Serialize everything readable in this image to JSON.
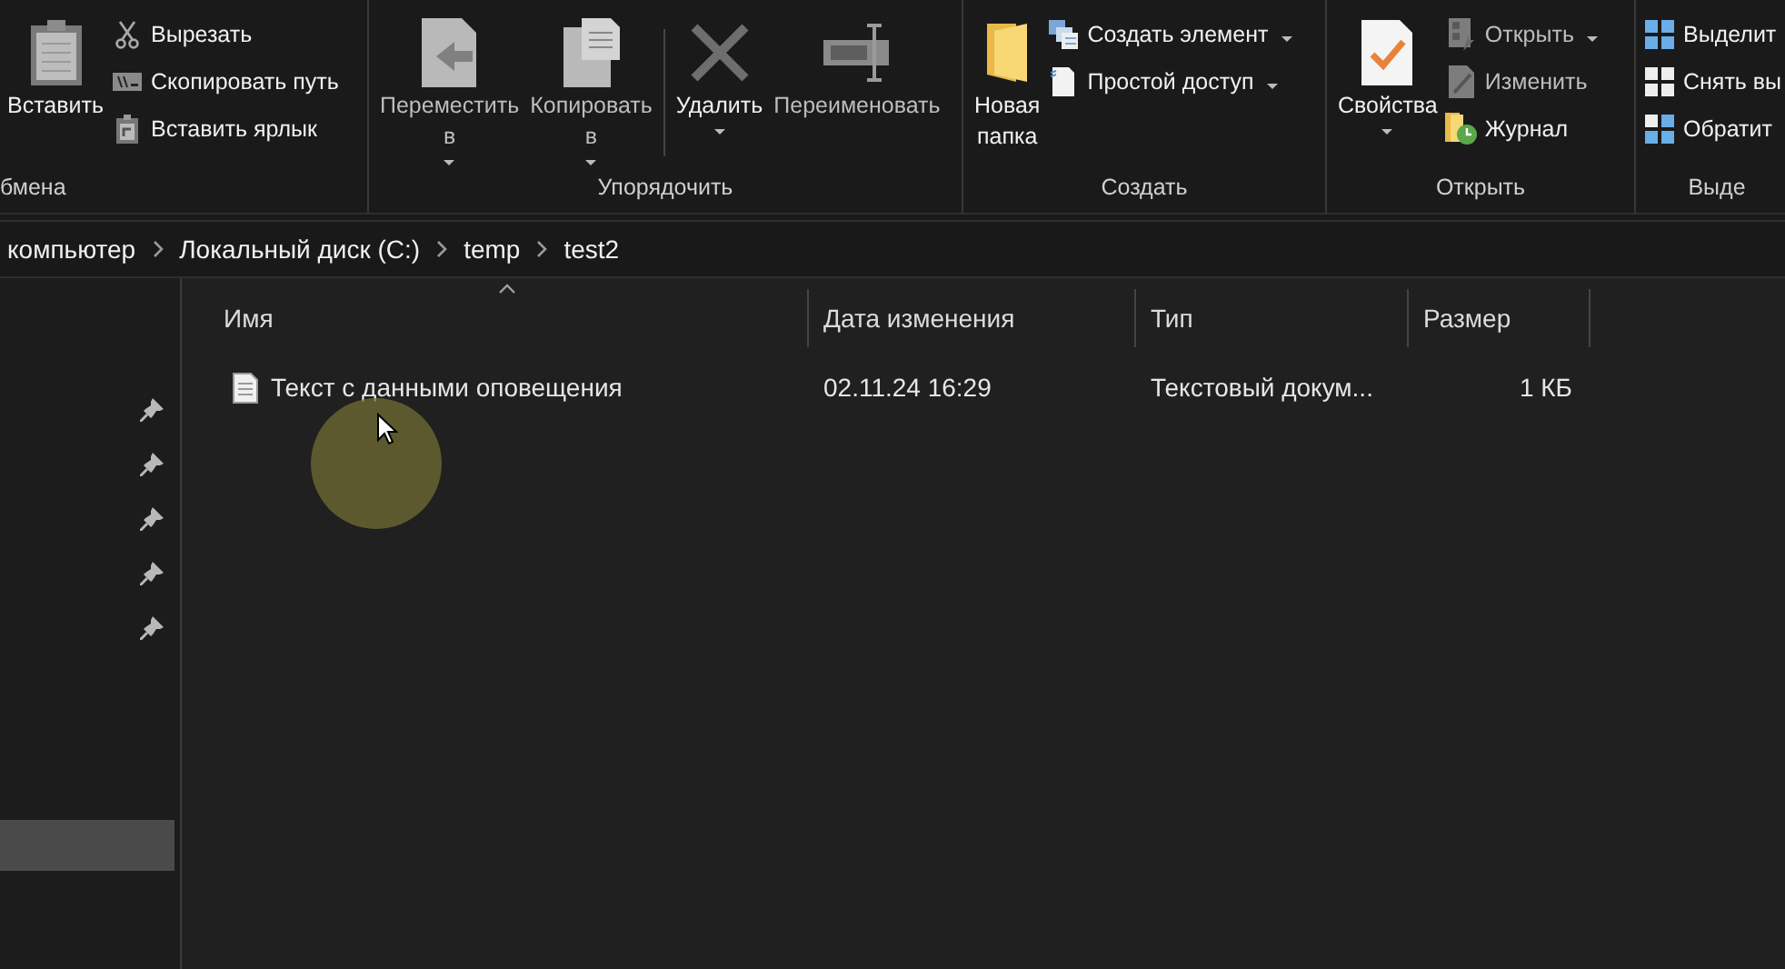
{
  "ribbon": {
    "groups": [
      {
        "label": "бмена",
        "commands": [
          {
            "kind": "large",
            "label": "Вставить",
            "dropdown": false,
            "disabled": false
          },
          {
            "kind": "stack",
            "items": [
              {
                "label": "Вырезать",
                "dropdown": false,
                "disabled": false
              },
              {
                "label": "Скопировать путь",
                "dropdown": false,
                "disabled": false
              },
              {
                "label": "Вставить ярлык",
                "dropdown": false,
                "disabled": false
              }
            ]
          }
        ]
      },
      {
        "label": "Упорядочить",
        "commands": [
          {
            "kind": "large",
            "label": "Переместить в",
            "dropdown": true,
            "disabled": true
          },
          {
            "kind": "large",
            "label": "Копировать в",
            "dropdown": true,
            "disabled": true
          },
          {
            "kind": "separator"
          },
          {
            "kind": "large",
            "label": "Удалить",
            "dropdown": true,
            "disabled": false
          },
          {
            "kind": "large",
            "label": "Переименовать",
            "dropdown": false,
            "disabled": true
          }
        ]
      },
      {
        "label": "Создать",
        "commands": [
          {
            "kind": "large",
            "label": "Новая папка",
            "dropdown": false,
            "disabled": false
          },
          {
            "kind": "stack",
            "items": [
              {
                "label": "Создать элемент",
                "dropdown": true,
                "disabled": false
              },
              {
                "label": "Простой доступ",
                "dropdown": true,
                "disabled": false
              }
            ]
          }
        ]
      },
      {
        "label": "Открыть",
        "commands": [
          {
            "kind": "large",
            "label": "Свойства",
            "dropdown": true,
            "disabled": false
          },
          {
            "kind": "stack",
            "items": [
              {
                "label": "Открыть",
                "dropdown": true,
                "disabled": true
              },
              {
                "label": "Изменить",
                "dropdown": false,
                "disabled": true
              },
              {
                "label": "Журнал",
                "dropdown": false,
                "disabled": false
              }
            ]
          }
        ]
      },
      {
        "label": "Выде",
        "commands": [
          {
            "kind": "stack",
            "items": [
              {
                "label": "Выделит",
                "dropdown": false,
                "disabled": false
              },
              {
                "label": "Снять вы",
                "dropdown": false,
                "disabled": false
              },
              {
                "label": "Обратит",
                "dropdown": false,
                "disabled": false
              }
            ]
          }
        ]
      }
    ]
  },
  "address": {
    "breadcrumbs": [
      "компьютер",
      "Локальный диск (C:)",
      "temp",
      "test2"
    ]
  },
  "sidebar": {
    "items": [
      {
        "pinned": true,
        "selected": false
      },
      {
        "pinned": true,
        "selected": false
      },
      {
        "pinned": true,
        "selected": false
      },
      {
        "pinned": true,
        "selected": false
      },
      {
        "pinned": true,
        "selected": false
      },
      {
        "pinned": false,
        "selected": false
      },
      {
        "pinned": false,
        "selected": false
      },
      {
        "pinned": false,
        "selected": false
      },
      {
        "pinned": false,
        "selected": true
      }
    ]
  },
  "file_list": {
    "columns": [
      {
        "label": "Имя",
        "sorted": true
      },
      {
        "label": "Дата изменения",
        "sorted": false
      },
      {
        "label": "Тип",
        "sorted": false
      },
      {
        "label": "Размер",
        "sorted": false
      }
    ],
    "rows": [
      {
        "name": "Текст с данными оповещения",
        "date": "02.11.24 16:29",
        "type": "Текстовый докум...",
        "size": "1 КБ"
      }
    ]
  }
}
